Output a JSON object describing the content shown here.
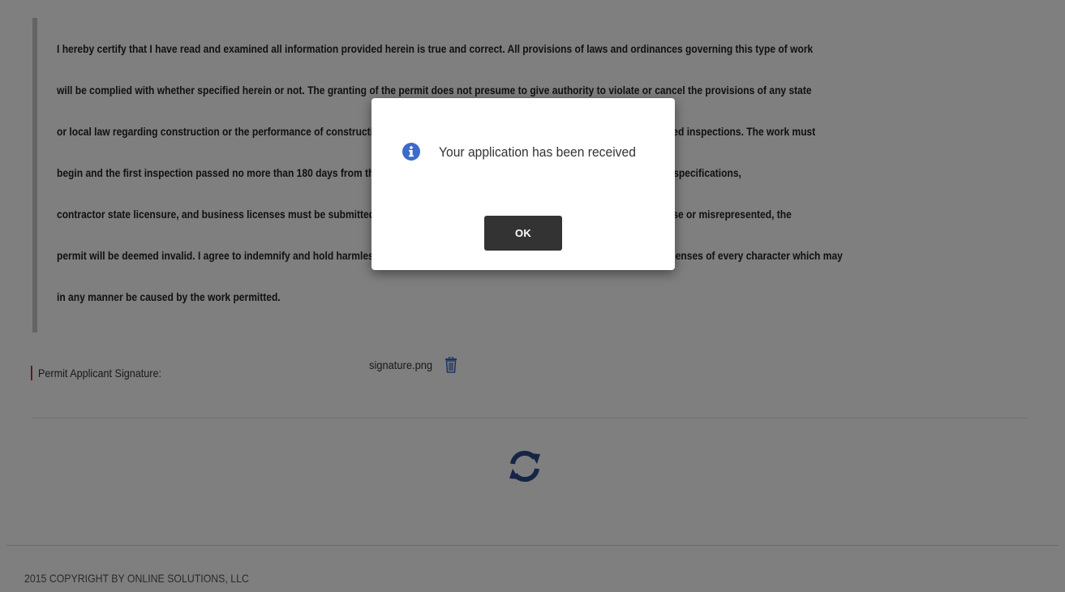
{
  "certification": {
    "lines": [
      "I hereby certify that I have read and examined all information provided herein is true and correct. All provisions of laws and ordinances governing this type of work",
      "will be complied with whether specified herein or not. The granting of the permit does not presume to give authority to violate or cancel the provisions of any state",
      "or local law regarding construction or the performance of construction, and the permit holder is responsible for scheduling all required inspections. The work must",
      "begin and the first inspection passed no more than 180 days from the date of issuance or the permit will be VOID. All required plans, specifications,",
      "contractor state licensure, and business licenses must be submitted. If any information provided in this application is found to be false or misrepresented, the",
      "permit will be deemed invalid. I agree to indemnify and hold harmless the jurisdiction against all liabilities, judgments, awards, or expenses of every character which may",
      "in any manner be caused by the work permitted."
    ]
  },
  "signature": {
    "label": "Permit Applicant Signature:",
    "filename": "signature.png",
    "delete_icon": "trash-icon",
    "required_color": "#c8161d"
  },
  "refresh": {
    "icon": "refresh-icon",
    "color": "#2d4a8a"
  },
  "footer": {
    "text": "2015 COPYRIGHT BY ONLINE SOLUTIONS, LLC"
  },
  "modal": {
    "message": "Your application has been received",
    "ok_label": "OK",
    "icon": "info-icon",
    "icon_color": "#3d6bc9"
  }
}
